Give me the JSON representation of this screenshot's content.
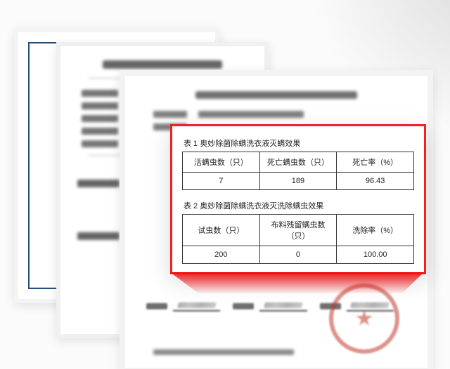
{
  "table1": {
    "caption": "表 1  奥妙除菌除螨洗衣液灭螨效果",
    "headers": [
      "活螨虫数（只）",
      "死亡螨虫数（只）",
      "死亡率（%）"
    ],
    "row": {
      "alive": "7",
      "dead": "189",
      "rate": "96.43"
    }
  },
  "table2": {
    "caption": "表 2  奥妙除菌除螨洗衣液灭洗除螨虫效果",
    "headers": [
      "试虫数（只）",
      "布料残留螨虫数（只）",
      "洗除率（%）"
    ],
    "row": {
      "total": "200",
      "residual": "0",
      "rate": "100.00"
    }
  }
}
